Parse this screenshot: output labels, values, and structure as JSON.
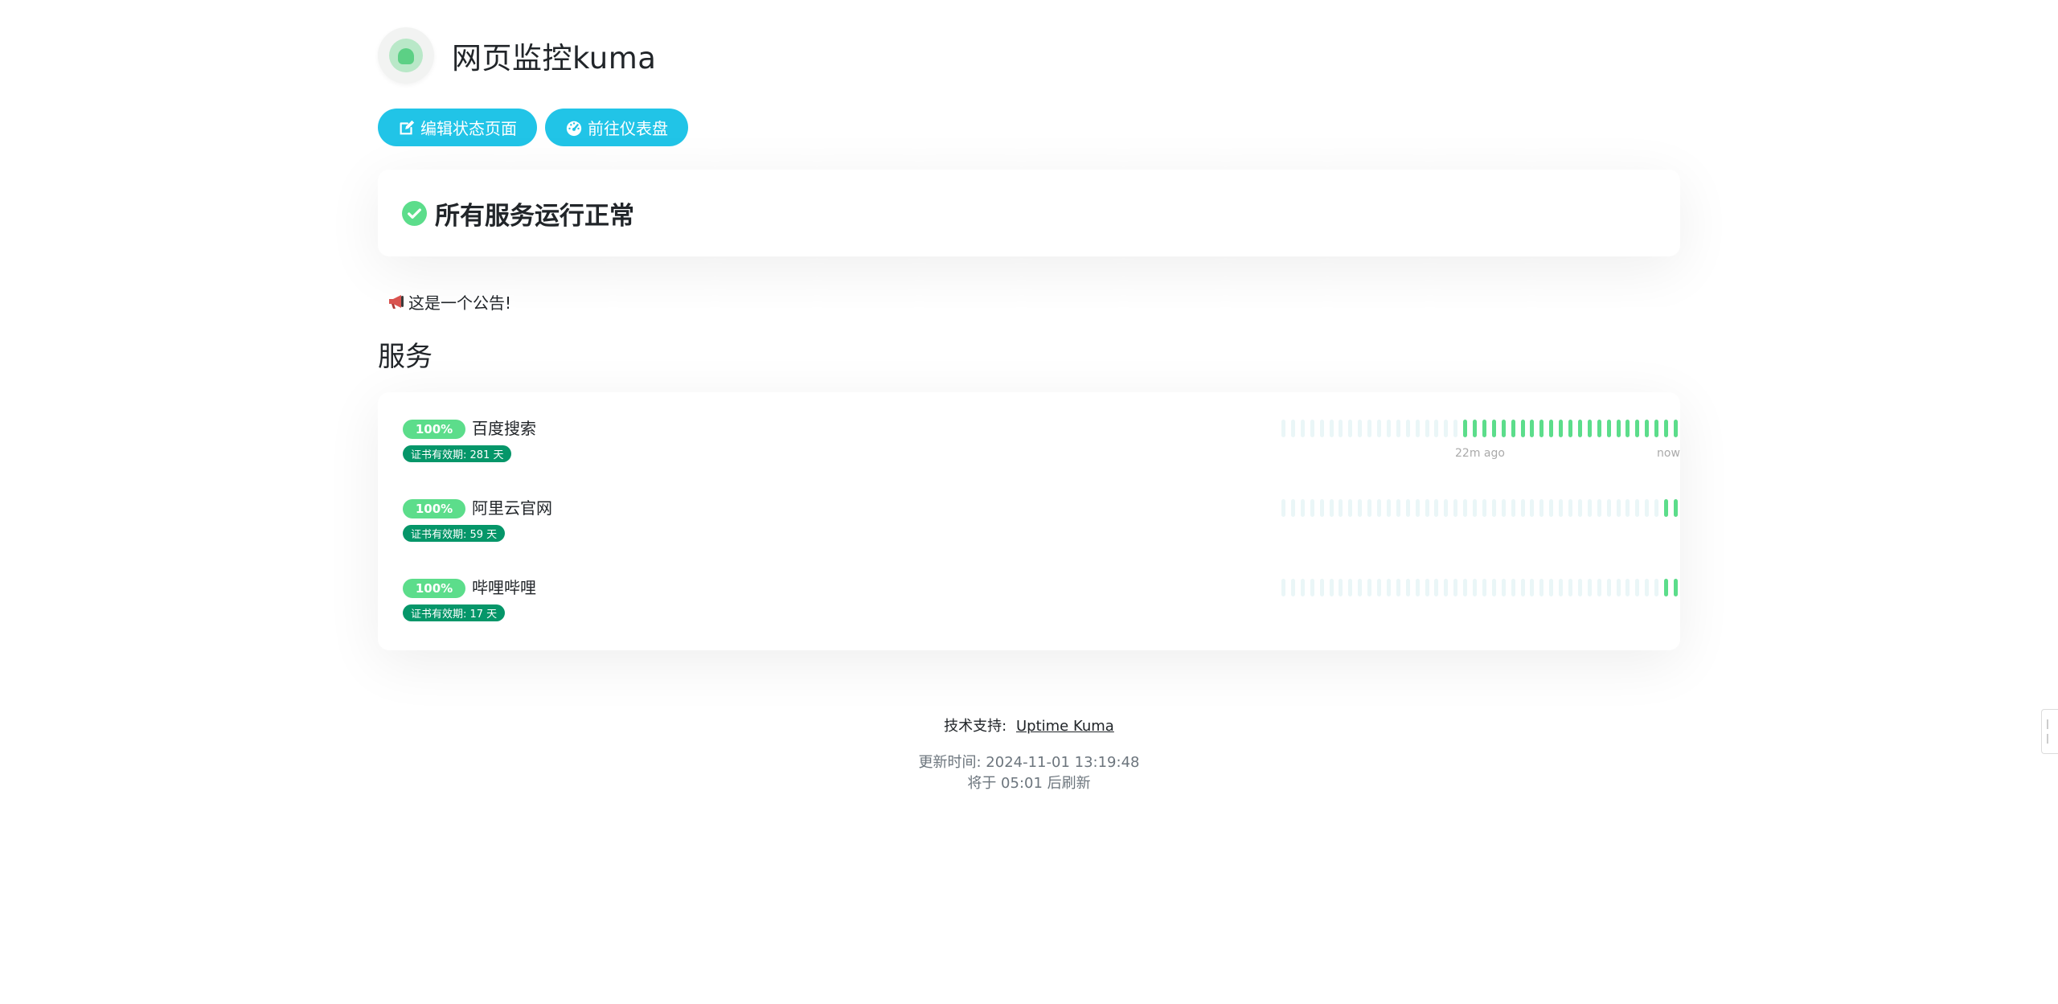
{
  "header": {
    "title": "网页监控kuma",
    "logo_icon": "uptime-kuma-logo"
  },
  "toolbar": {
    "edit_label": "编辑状态页面",
    "edit_icon": "edit-icon",
    "dashboard_label": "前往仪表盘",
    "dashboard_icon": "gauge-icon"
  },
  "status": {
    "text": "所有服务运行正常",
    "icon": "check-circle-icon"
  },
  "announcement": {
    "icon": "megaphone-icon",
    "text": "这是一个公告!"
  },
  "section_title": "服务",
  "services": [
    {
      "uptime": "100%",
      "name": "百度搜索",
      "cert": "证书有效期: 281 天",
      "beats_total": 42,
      "beats_up": 23,
      "time_left": "22m ago",
      "time_right": "now"
    },
    {
      "uptime": "100%",
      "name": "阿里云官网",
      "cert": "证书有效期: 59 天",
      "beats_total": 42,
      "beats_up": 2
    },
    {
      "uptime": "100%",
      "name": "哔哩哔哩",
      "cert": "证书有效期: 17 天",
      "beats_total": 42,
      "beats_up": 2
    }
  ],
  "footer": {
    "powered_label": "技术支持:",
    "powered_link": "Uptime Kuma",
    "updated": "更新时间: 2024-11-01 13:19:48",
    "refresh": "将于 05:01 后刷新"
  },
  "colors": {
    "primary": "#21c4e7",
    "up": "#5cdd8b",
    "empty_beat": "#eaf6f7",
    "cert_badge": "#059669"
  }
}
